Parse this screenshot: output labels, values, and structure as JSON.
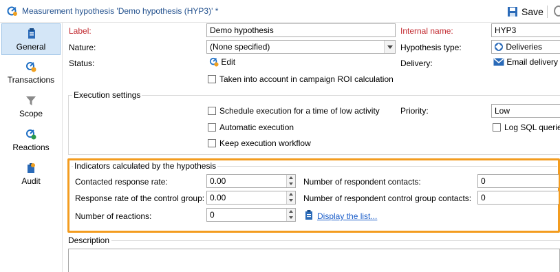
{
  "window": {
    "title": "Measurement hypothesis 'Demo hypothesis (HYP3)' *",
    "save_label": "Save"
  },
  "sidebar": {
    "items": [
      {
        "label": "General",
        "icon": "general-icon"
      },
      {
        "label": "Transactions",
        "icon": "transactions-icon"
      },
      {
        "label": "Scope",
        "icon": "filter-icon"
      },
      {
        "label": "Reactions",
        "icon": "reactions-icon"
      },
      {
        "label": "Audit",
        "icon": "audit-icon"
      }
    ]
  },
  "general": {
    "label_label": "Label:",
    "label_value": "Demo hypothesis",
    "internal_name_label": "Internal name:",
    "internal_name_value": "HYP3",
    "nature_label": "Nature:",
    "nature_value": "(None specified)",
    "hypothesis_type_label": "Hypothesis type:",
    "hypothesis_type_value": "Deliveries",
    "status_label": "Status:",
    "status_value": "Edit",
    "delivery_label": "Delivery:",
    "delivery_value": "Email delivery",
    "roi_checkbox": "Taken into account in campaign ROI calculation"
  },
  "execution": {
    "title": "Execution settings",
    "schedule_checkbox": "Schedule execution for a time of low activity",
    "priority_label": "Priority:",
    "priority_value": "Low",
    "automatic_checkbox": "Automatic execution",
    "log_sql_checkbox": "Log SQL queries",
    "keep_workflow_checkbox": "Keep execution workflow"
  },
  "indicators": {
    "title": "Indicators calculated by the hypothesis",
    "contacted_rate_label": "Contacted response rate:",
    "contacted_rate_value": "0.00",
    "respondent_contacts_label": "Number of respondent contacts:",
    "respondent_contacts_value": "0",
    "control_rate_label": "Response rate of the control group:",
    "control_rate_value": "0.00",
    "respondent_control_label": "Number of respondent control group contacts:",
    "respondent_control_value": "0",
    "reactions_label": "Number of reactions:",
    "reactions_value": "0",
    "display_list_link": "Display the list..."
  },
  "description": {
    "title": "Description",
    "value": ""
  },
  "colors": {
    "highlight": "#f39c1f",
    "required_label": "#c1272d",
    "title_text": "#1f4e8c",
    "active_tab": "#d4e6f7",
    "link": "#1a5dc9"
  }
}
